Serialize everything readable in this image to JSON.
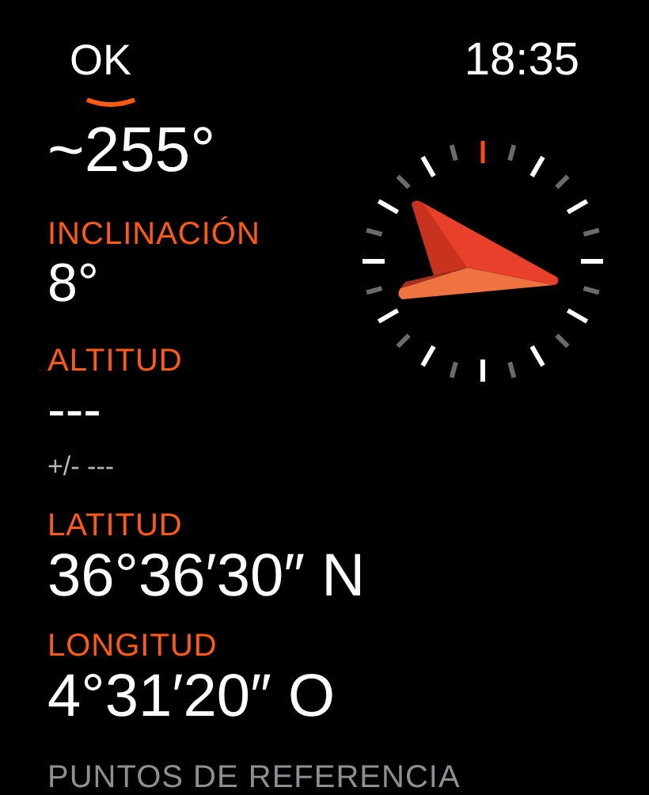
{
  "status_bar": {
    "back_label": "OK",
    "time": "18:35"
  },
  "heading": {
    "value": "~255°"
  },
  "readings": [
    {
      "label": "INCLINACIÓN",
      "value": "8°"
    },
    {
      "label": "ALTITUD",
      "value": "---",
      "accuracy": "+/- ---"
    },
    {
      "label": "LATITUD",
      "value": "36°36′30″ N"
    },
    {
      "label": "LONGITUD",
      "value": "4°31′20″ O"
    }
  ],
  "section_header": "PUNTOS DE REFERENCIA"
}
